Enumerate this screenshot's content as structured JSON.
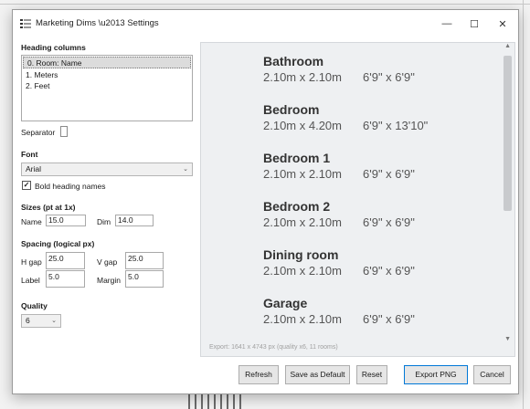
{
  "window": {
    "title": "Marketing Dims \\u2013 Settings",
    "minimize_glyph": "—",
    "maximize_glyph": "☐",
    "close_glyph": "✕"
  },
  "heading_columns": {
    "label": "Heading columns",
    "items": [
      "0.  Room: Name",
      "1.  Meters",
      "2.  Feet"
    ],
    "selected_index": 0
  },
  "separator": {
    "label": "Separator",
    "value": ""
  },
  "font": {
    "label": "Font",
    "selected": "Arial",
    "bold_heading_names": {
      "label": "Bold heading names",
      "checked": true
    }
  },
  "sizes": {
    "label": "Sizes  (pt at 1x)",
    "name_label": "Name",
    "name_value": "15.0",
    "dim_label": "Dim",
    "dim_value": "14.0"
  },
  "spacing": {
    "label": "Spacing  (logical px)",
    "hgap_label": "H gap",
    "hgap_value": "25.0",
    "vgap_label": "V gap",
    "vgap_value": "25.0",
    "label_label": "Label",
    "label_value": "5.0",
    "margin_label": "Margin",
    "margin_value": "5.0"
  },
  "quality": {
    "label": "Quality",
    "selected": "6"
  },
  "preview": {
    "rooms": [
      {
        "name": "Bathroom",
        "metric": "2.10m x 2.10m",
        "imperial": "6'9\" x 6'9\""
      },
      {
        "name": "Bedroom",
        "metric": "2.10m x 4.20m",
        "imperial": "6'9\" x 13'10\""
      },
      {
        "name": "Bedroom 1",
        "metric": "2.10m x 2.10m",
        "imperial": "6'9\" x 6'9\""
      },
      {
        "name": "Bedroom 2",
        "metric": "2.10m x 2.10m",
        "imperial": "6'9\" x 6'9\""
      },
      {
        "name": "Dining room",
        "metric": "2.10m x 2.10m",
        "imperial": "6'9\" x 6'9\""
      },
      {
        "name": "Garage",
        "metric": "2.10m x 2.10m",
        "imperial": "6'9\" x 6'9\""
      }
    ],
    "export_info": "Export: 1641 x 4743 px  (quality x6, 11 rooms)"
  },
  "buttons": {
    "refresh": "Refresh",
    "save_default": "Save as Default",
    "reset": "Reset",
    "export_png": "Export PNG",
    "cancel": "Cancel"
  },
  "colors": {
    "accent": "#0078d7",
    "preview_bg": "#eef0f2"
  }
}
